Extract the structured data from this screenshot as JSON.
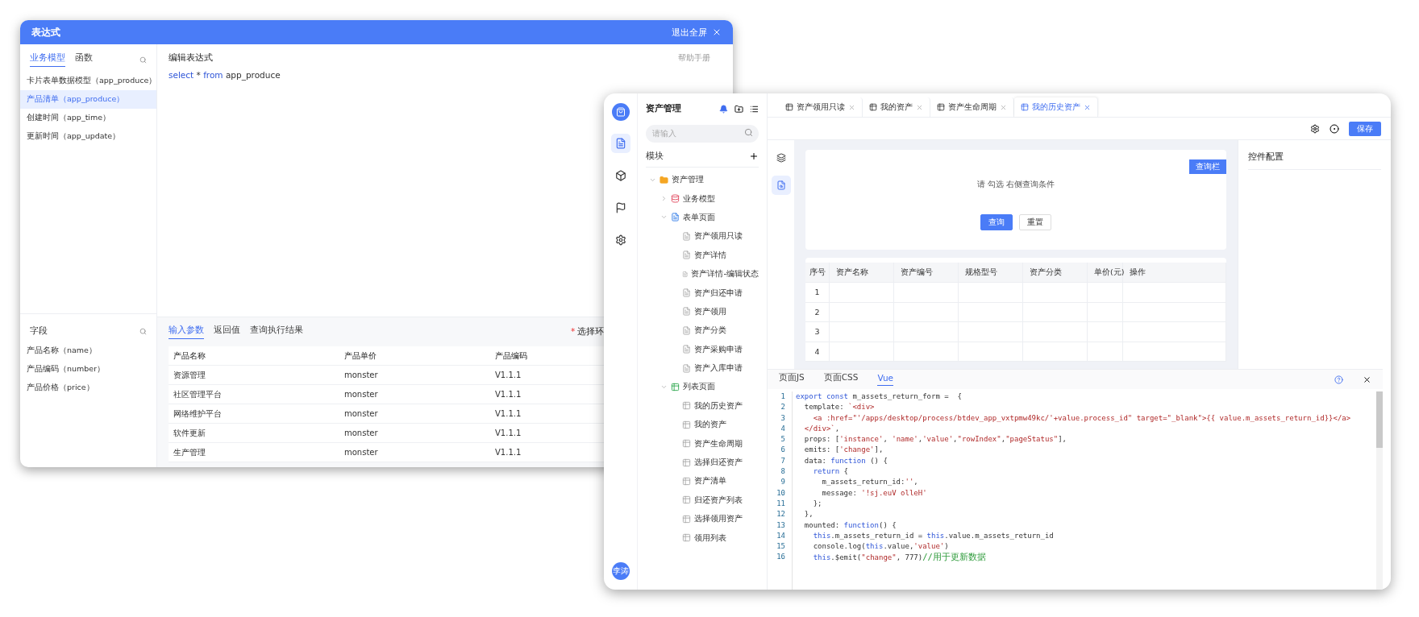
{
  "expression_window": {
    "title": "表达式",
    "exit_label": "退出全屏",
    "model_tabs": [
      {
        "label": "业务模型",
        "selected": true
      },
      {
        "label": "函数",
        "selected": false
      }
    ],
    "models": [
      {
        "label": "卡片表单数据模型（app_produce）",
        "selected": false
      },
      {
        "label": "产品清单（app_produce）",
        "selected": true
      },
      {
        "label": "创建时间（app_time）",
        "selected": false
      },
      {
        "label": "更新时间（app_update）",
        "selected": false
      }
    ],
    "fields_title": "字段",
    "fields": [
      "产品名称（name）",
      "产品编码（number）",
      "产品价格（price）"
    ],
    "editor_title": "编辑表达式",
    "help_link": "帮助手册",
    "expression": [
      {
        "text": "select",
        "kind": "keyword"
      },
      {
        "text": " * ",
        "kind": "plain"
      },
      {
        "text": "from",
        "kind": "keyword"
      },
      {
        "text": " app_produce",
        "kind": "plain"
      }
    ],
    "result_tabs": [
      {
        "label": "输入参数",
        "selected": true
      },
      {
        "label": "返回值",
        "selected": false
      },
      {
        "label": "查询执行结果",
        "selected": false
      }
    ],
    "environment": {
      "label": "选择环",
      "required": true
    },
    "table": {
      "columns": [
        "产品名称",
        "产品单价",
        "产品编码"
      ],
      "rows": [
        [
          "资源管理",
          "monster",
          "V1.1.1"
        ],
        [
          "社区管理平台",
          "monster",
          "V1.1.1"
        ],
        [
          "网络维护平台",
          "monster",
          "V1.1.1"
        ],
        [
          "软件更新",
          "monster",
          "V1.1.1"
        ],
        [
          "生产管理",
          "monster",
          "V1.1.1"
        ]
      ]
    }
  },
  "designer_window": {
    "rail": [
      {
        "kind": "pages",
        "selected": true
      },
      {
        "kind": "components",
        "selected": false
      },
      {
        "kind": "flows",
        "selected": false
      },
      {
        "kind": "settings",
        "selected": false
      }
    ],
    "user_avatar": "李涛",
    "sidebar": {
      "title": "资产管理",
      "search_placeholder": "请输入",
      "section_title": "模块",
      "tree": [
        {
          "label": "资产管理",
          "kind": "folder",
          "expanded": true,
          "children": [
            {
              "label": "业务模型",
              "kind": "model",
              "expanded": false
            },
            {
              "label": "表单页面",
              "kind": "form-group",
              "expanded": true,
              "children": [
                {
                  "label": "资产领用只读",
                  "kind": "form-page"
                },
                {
                  "label": "资产详情",
                  "kind": "form-page"
                },
                {
                  "label": "资产详情-编辑状态",
                  "kind": "form-page"
                },
                {
                  "label": "资产归还申请",
                  "kind": "form-page"
                },
                {
                  "label": "资产领用",
                  "kind": "form-page"
                },
                {
                  "label": "资产分类",
                  "kind": "form-page"
                },
                {
                  "label": "资产采购申请",
                  "kind": "form-page"
                },
                {
                  "label": "资产入库申请",
                  "kind": "form-page"
                }
              ]
            },
            {
              "label": "列表页面",
              "kind": "list-group",
              "expanded": true,
              "children": [
                {
                  "label": "我的历史资产",
                  "kind": "list-page"
                },
                {
                  "label": "我的资产",
                  "kind": "list-page"
                },
                {
                  "label": "资产生命周期",
                  "kind": "list-page"
                },
                {
                  "label": "选择归还资产",
                  "kind": "list-page"
                },
                {
                  "label": "资产清单",
                  "kind": "list-page"
                },
                {
                  "label": "归还资产列表",
                  "kind": "list-page"
                },
                {
                  "label": "选择领用资产",
                  "kind": "list-page"
                },
                {
                  "label": "领用列表",
                  "kind": "list-page"
                }
              ]
            }
          ]
        }
      ]
    },
    "tabs": [
      {
        "label": "资产领用只读",
        "selected": false
      },
      {
        "label": "我的资产",
        "selected": false
      },
      {
        "label": "资产生命周期",
        "selected": false
      },
      {
        "label": "我的历史资产",
        "selected": true
      }
    ],
    "save_label": "保存",
    "tool_rail": [
      {
        "kind": "layers",
        "selected": false
      },
      {
        "kind": "page",
        "selected": true
      }
    ],
    "query_card": {
      "badge": "查询栏",
      "hint": "请 勾选 右侧查询条件",
      "buttons": [
        {
          "label": "查询",
          "kind": "primary"
        },
        {
          "label": "重置",
          "kind": "default"
        }
      ]
    },
    "table": {
      "columns": [
        "序号",
        "资产名称",
        "资产编号",
        "规格型号",
        "资产分类",
        "单价(元)",
        "操作"
      ],
      "rows": [
        "1",
        "2",
        "3",
        "4"
      ]
    },
    "config_title": "控件配置",
    "code_tabs": [
      {
        "label": "页面JS",
        "selected": false
      },
      {
        "label": "页面CSS",
        "selected": false
      },
      {
        "label": "Vue",
        "selected": true
      }
    ],
    "code_lines": [
      {
        "num": "1",
        "tokens": [
          {
            "text": "export const",
            "kind": "keyword"
          },
          {
            "text": " m_assets_return_form =  {",
            "kind": "plain"
          }
        ]
      },
      {
        "num": "2",
        "tokens": [
          {
            "text": "  template: ",
            "kind": "plain"
          },
          {
            "text": "`<div>",
            "kind": "string"
          }
        ]
      },
      {
        "num": "3",
        "tokens": [
          {
            "text": "    <a :href=\"'/apps/desktop/process/btdev_app_vxtpmw49kc/'+value.process_id\" target=\"_blank\">{{ value.m_assets_return_id}}</a>",
            "kind": "string"
          }
        ]
      },
      {
        "num": "4",
        "tokens": [
          {
            "text": "  </div>`",
            "kind": "string"
          },
          {
            "text": ",",
            "kind": "plain"
          }
        ]
      },
      {
        "num": "5",
        "tokens": [
          {
            "text": "  props: [",
            "kind": "plain"
          },
          {
            "text": "'instance'",
            "kind": "string"
          },
          {
            "text": ", ",
            "kind": "plain"
          },
          {
            "text": "'name'",
            "kind": "string"
          },
          {
            "text": ",",
            "kind": "plain"
          },
          {
            "text": "'value'",
            "kind": "string"
          },
          {
            "text": ",",
            "kind": "plain"
          },
          {
            "text": "\"rowIndex\"",
            "kind": "string"
          },
          {
            "text": ",",
            "kind": "plain"
          },
          {
            "text": "\"pageStatus\"",
            "kind": "string"
          },
          {
            "text": "],",
            "kind": "plain"
          }
        ]
      },
      {
        "num": "6",
        "tokens": [
          {
            "text": "  emits: [",
            "kind": "plain"
          },
          {
            "text": "'change'",
            "kind": "string"
          },
          {
            "text": "],",
            "kind": "plain"
          }
        ]
      },
      {
        "num": "7",
        "tokens": [
          {
            "text": "  data: ",
            "kind": "plain"
          },
          {
            "text": "function",
            "kind": "keyword"
          },
          {
            "text": " () {",
            "kind": "plain"
          }
        ]
      },
      {
        "num": "8",
        "tokens": [
          {
            "text": "    return",
            "kind": "keyword"
          },
          {
            "text": " {",
            "kind": "plain"
          }
        ]
      },
      {
        "num": "9",
        "tokens": [
          {
            "text": "      m_assets_return_id:",
            "kind": "plain"
          },
          {
            "text": "''",
            "kind": "string"
          },
          {
            "text": ",",
            "kind": "plain"
          }
        ]
      },
      {
        "num": "10",
        "tokens": [
          {
            "text": "      message: ",
            "kind": "plain"
          },
          {
            "text": "'!sj.euV olleH'",
            "kind": "string"
          }
        ]
      },
      {
        "num": "11",
        "tokens": [
          {
            "text": "    };",
            "kind": "plain"
          }
        ]
      },
      {
        "num": "12",
        "tokens": [
          {
            "text": "  },",
            "kind": "plain"
          }
        ]
      },
      {
        "num": "13",
        "tokens": [
          {
            "text": "  mounted: ",
            "kind": "plain"
          },
          {
            "text": "function",
            "kind": "keyword"
          },
          {
            "text": "() {",
            "kind": "plain"
          }
        ]
      },
      {
        "num": "14",
        "tokens": [
          {
            "text": "    this",
            "kind": "keyword"
          },
          {
            "text": ".m_assets_return_id = ",
            "kind": "plain"
          },
          {
            "text": "this",
            "kind": "keyword"
          },
          {
            "text": ".value.m_assets_return_id",
            "kind": "plain"
          }
        ]
      },
      {
        "num": "15",
        "tokens": [
          {
            "text": "    console.log(",
            "kind": "plain"
          },
          {
            "text": "this",
            "kind": "keyword"
          },
          {
            "text": ".value,",
            "kind": "plain"
          },
          {
            "text": "'value'",
            "kind": "string"
          },
          {
            "text": ")",
            "kind": "plain"
          }
        ]
      },
      {
        "num": "16",
        "tokens": [
          {
            "text": "    this",
            "kind": "keyword"
          },
          {
            "text": ".$emit(",
            "kind": "plain"
          },
          {
            "text": "\"change\"",
            "kind": "string"
          },
          {
            "text": ", 777)",
            "kind": "plain"
          },
          {
            "text": "//用于更新数据",
            "kind": "comment"
          }
        ]
      }
    ]
  }
}
